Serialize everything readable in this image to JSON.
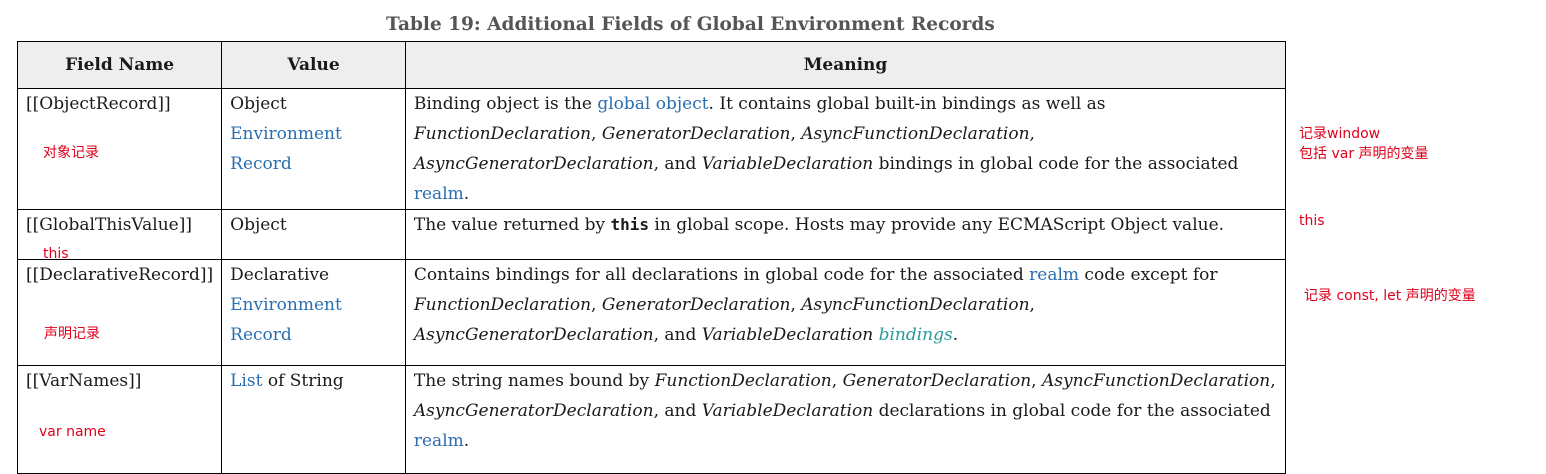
{
  "caption": "Table 19: Additional Fields of Global Environment Records",
  "headers": {
    "field": "Field Name",
    "value": "Value",
    "meaning": "Meaning"
  },
  "rows": [
    {
      "field": "[[ObjectRecord]]",
      "annotation": "对象记录",
      "value": {
        "plain": "Object",
        "link": "Environment Record"
      },
      "meaning": {
        "t1": "Binding object is the ",
        "link1": "global object",
        "t2": ". It contains global built-in bindings as well as ",
        "i1": "FunctionDeclaration",
        "sep1": ", ",
        "i2": "GeneratorDeclaration",
        "sep2": ", ",
        "i3": "AsyncFunctionDeclaration",
        "sep3": ", ",
        "i4": "AsyncGeneratorDeclaration",
        "sep4": ", and ",
        "i5": "VariableDeclaration",
        "t3": " bindings in global code for the associated ",
        "link2": "realm",
        "t4": "."
      },
      "side_note": [
        "记录window",
        "包括 var 声明的变量"
      ]
    },
    {
      "field": "[[GlobalThisValue]]",
      "annotation": "this",
      "value": {
        "plain": "Object"
      },
      "meaning": {
        "t1": "The value returned by ",
        "code": "this",
        "t2": " in global scope. Hosts may provide any ECMAScript Object value."
      },
      "side_note": [
        "this"
      ]
    },
    {
      "field": "[[DeclarativeRecord]]",
      "annotation": "声明记录",
      "value": {
        "plain": "Declarative",
        "link": "Environment Record"
      },
      "meaning": {
        "t1": "Contains bindings for all declarations in global code for the associated ",
        "link1": "realm",
        "t2": " code except for ",
        "i1": "FunctionDeclaration",
        "sep1": ", ",
        "i2": "GeneratorDeclaration",
        "sep2": ", ",
        "i3": "AsyncFunctionDeclaration",
        "sep3": ", ",
        "i4": "AsyncGeneratorDeclaration",
        "sep4": ", and ",
        "i5": "VariableDeclaration",
        "sp": " ",
        "link2": "bindings",
        "t3": "."
      },
      "side_note": [
        "记录 const, let 声明的变量"
      ]
    },
    {
      "field": "[[VarNames]]",
      "annotation": "var name",
      "value": {
        "link": "List",
        "plain": " of String"
      },
      "meaning": {
        "t1": "The string names bound by ",
        "i1": "FunctionDeclaration",
        "sep1": ", ",
        "i2": "GeneratorDeclaration",
        "sep2": ", ",
        "i3": "AsyncFunctionDeclaration",
        "sep3": ", ",
        "i4": "AsyncGeneratorDeclaration",
        "sep4": ", and ",
        "i5": "VariableDeclaration",
        "t2": " declarations in global code for the associated ",
        "link1": "realm",
        "t3": "."
      }
    }
  ],
  "colors": {
    "link": "#2a6eb0",
    "link_alt": "#2a9a9a",
    "annotation": "#e0001b",
    "header_bg": "#eeeeee"
  }
}
